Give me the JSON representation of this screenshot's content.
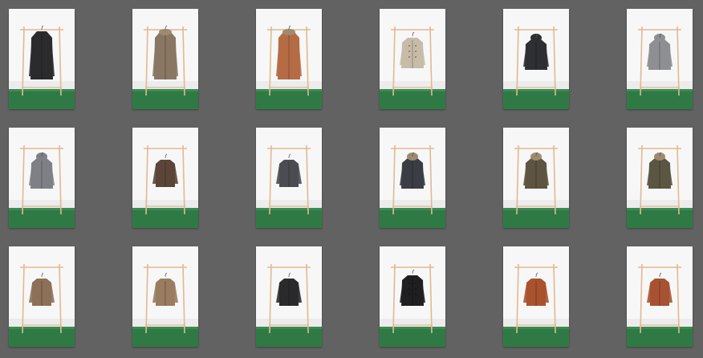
{
  "gallery": {
    "items": [
      {
        "garment": "long-coat",
        "color": "#2b2b2d",
        "fur": false
      },
      {
        "garment": "long-coat",
        "color": "#8a7763",
        "fur": true
      },
      {
        "garment": "long-coat",
        "color": "#b56c45",
        "fur": true
      },
      {
        "garment": "pea-coat",
        "color": "#c8bca9",
        "fur": false
      },
      {
        "garment": "hooded-jacket",
        "color": "#2e2f33",
        "fur": false
      },
      {
        "garment": "hooded-jacket",
        "color": "#8e8f93",
        "fur": false
      },
      {
        "garment": "hooded-jacket",
        "color": "#7f8085",
        "fur": false
      },
      {
        "garment": "blazer",
        "color": "#5a4538",
        "fur": false
      },
      {
        "garment": "blazer",
        "color": "#4a4c52",
        "fur": false
      },
      {
        "garment": "parka",
        "color": "#3a3d44",
        "fur": true
      },
      {
        "garment": "parka",
        "color": "#5d5441",
        "fur": true
      },
      {
        "garment": "parka",
        "color": "#5a5642",
        "fur": true
      },
      {
        "garment": "jacket",
        "color": "#8c7058",
        "fur": false
      },
      {
        "garment": "jacket",
        "color": "#9a7c60",
        "fur": false
      },
      {
        "garment": "jacket",
        "color": "#2a2a2c",
        "fur": false
      },
      {
        "garment": "pea-coat",
        "color": "#1f1f22",
        "fur": false
      },
      {
        "garment": "leather-jacket",
        "color": "#a9522e",
        "fur": false
      },
      {
        "garment": "leather-jacket",
        "color": "#a75232",
        "fur": false
      }
    ],
    "colors": {
      "background": "#626262",
      "wall": "#f7f7f7",
      "carpet": "#2f7a44",
      "rack": "#e3b891"
    }
  }
}
